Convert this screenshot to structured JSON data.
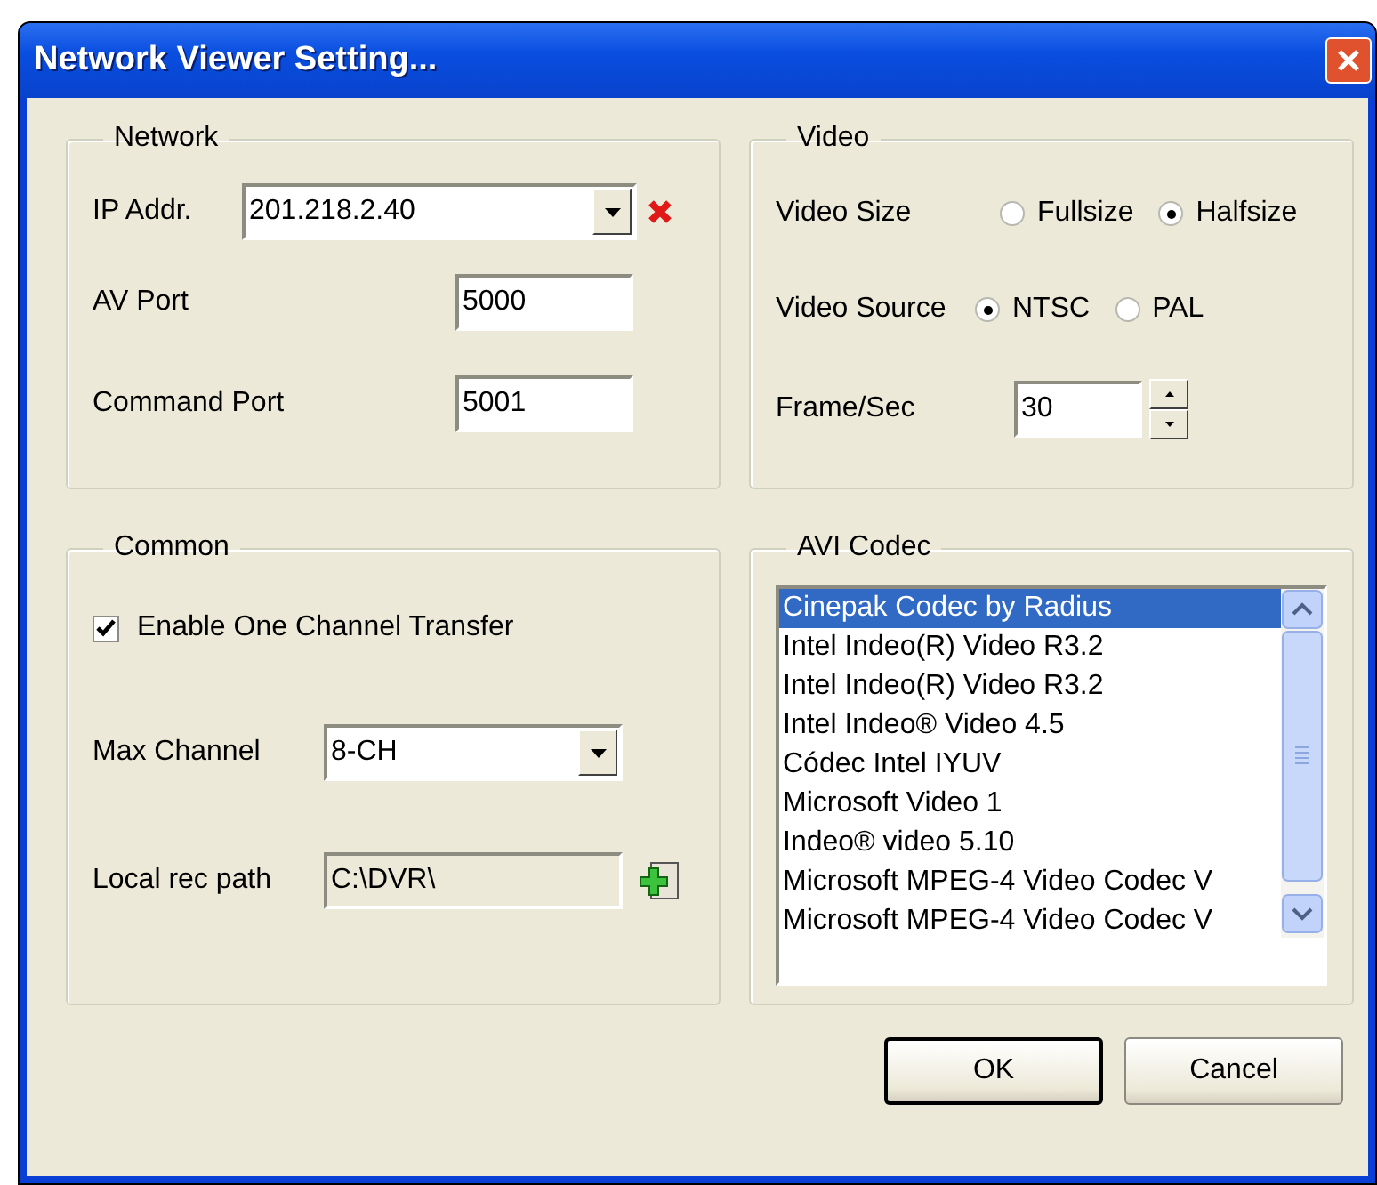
{
  "window": {
    "title": "Network Viewer Setting..."
  },
  "network": {
    "title": "Network",
    "ip_label": "IP Addr.",
    "ip_value": "201.218.2.40",
    "av_port_label": "AV Port",
    "av_port_value": "5000",
    "command_port_label": "Command Port",
    "command_port_value": "5001"
  },
  "video": {
    "title": "Video",
    "size_label": "Video Size",
    "size_options": [
      {
        "label": "Fullsize",
        "selected": false
      },
      {
        "label": "Halfsize",
        "selected": true
      }
    ],
    "source_label": "Video Source",
    "source_options": [
      {
        "label": "NTSC",
        "selected": true
      },
      {
        "label": "PAL",
        "selected": false
      }
    ],
    "fps_label": "Frame/Sec",
    "fps_value": "30"
  },
  "common": {
    "title": "Common",
    "enable_one_channel": {
      "label": "Enable One Channel Transfer",
      "checked": true
    },
    "max_channel_label": "Max Channel",
    "max_channel_value": "8-CH",
    "rec_path_label": "Local rec path",
    "rec_path_value": "C:\\DVR\\"
  },
  "avi_codec": {
    "title": "AVI Codec",
    "items": [
      {
        "label": "Cinepak Codec by Radius",
        "selected": true
      },
      {
        "label": "Intel Indeo(R) Video R3.2",
        "selected": false
      },
      {
        "label": "Intel Indeo(R) Video R3.2",
        "selected": false
      },
      {
        "label": "Intel Indeo® Video 4.5",
        "selected": false
      },
      {
        "label": "Códec Intel IYUV",
        "selected": false
      },
      {
        "label": "Microsoft Video 1",
        "selected": false
      },
      {
        "label": "Indeo® video 5.10",
        "selected": false
      },
      {
        "label": "Microsoft MPEG-4 Video Codec V",
        "selected": false
      },
      {
        "label": "Microsoft MPEG-4 Video Codec V",
        "selected": false
      }
    ]
  },
  "buttons": [
    {
      "label": "OK",
      "default": true
    },
    {
      "label": "Cancel",
      "default": false
    }
  ]
}
